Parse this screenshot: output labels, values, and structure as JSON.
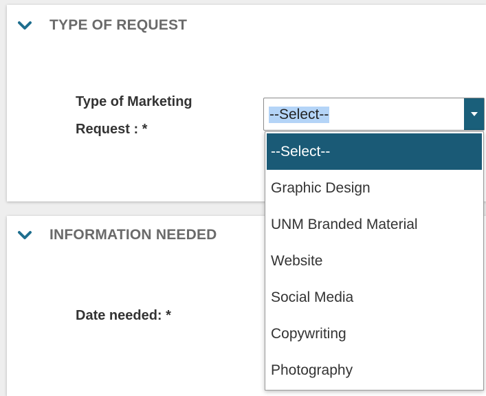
{
  "sections": {
    "type_of_request": {
      "title": "TYPE OF REQUEST",
      "field_label": "Type of Marketing Request : *",
      "select_value": "--Select--"
    },
    "information_needed": {
      "title": "INFORMATION NEEDED",
      "field_label": "Date needed: *"
    }
  },
  "dropdown": {
    "options": [
      "--Select--",
      "Graphic Design",
      "UNM Branded Material",
      "Website",
      "Social Media",
      "Copywriting",
      "Photography"
    ],
    "selected_index": 0
  },
  "icons": {
    "collapse": "chevron-down-icon",
    "select_arrow": "caret-down-icon"
  },
  "colors": {
    "accent": "#1a5a76",
    "chevron": "#1f6f8f",
    "selection_highlight": "#b4d4f7",
    "header_text": "#6a6a6a",
    "label_text": "#333333"
  }
}
